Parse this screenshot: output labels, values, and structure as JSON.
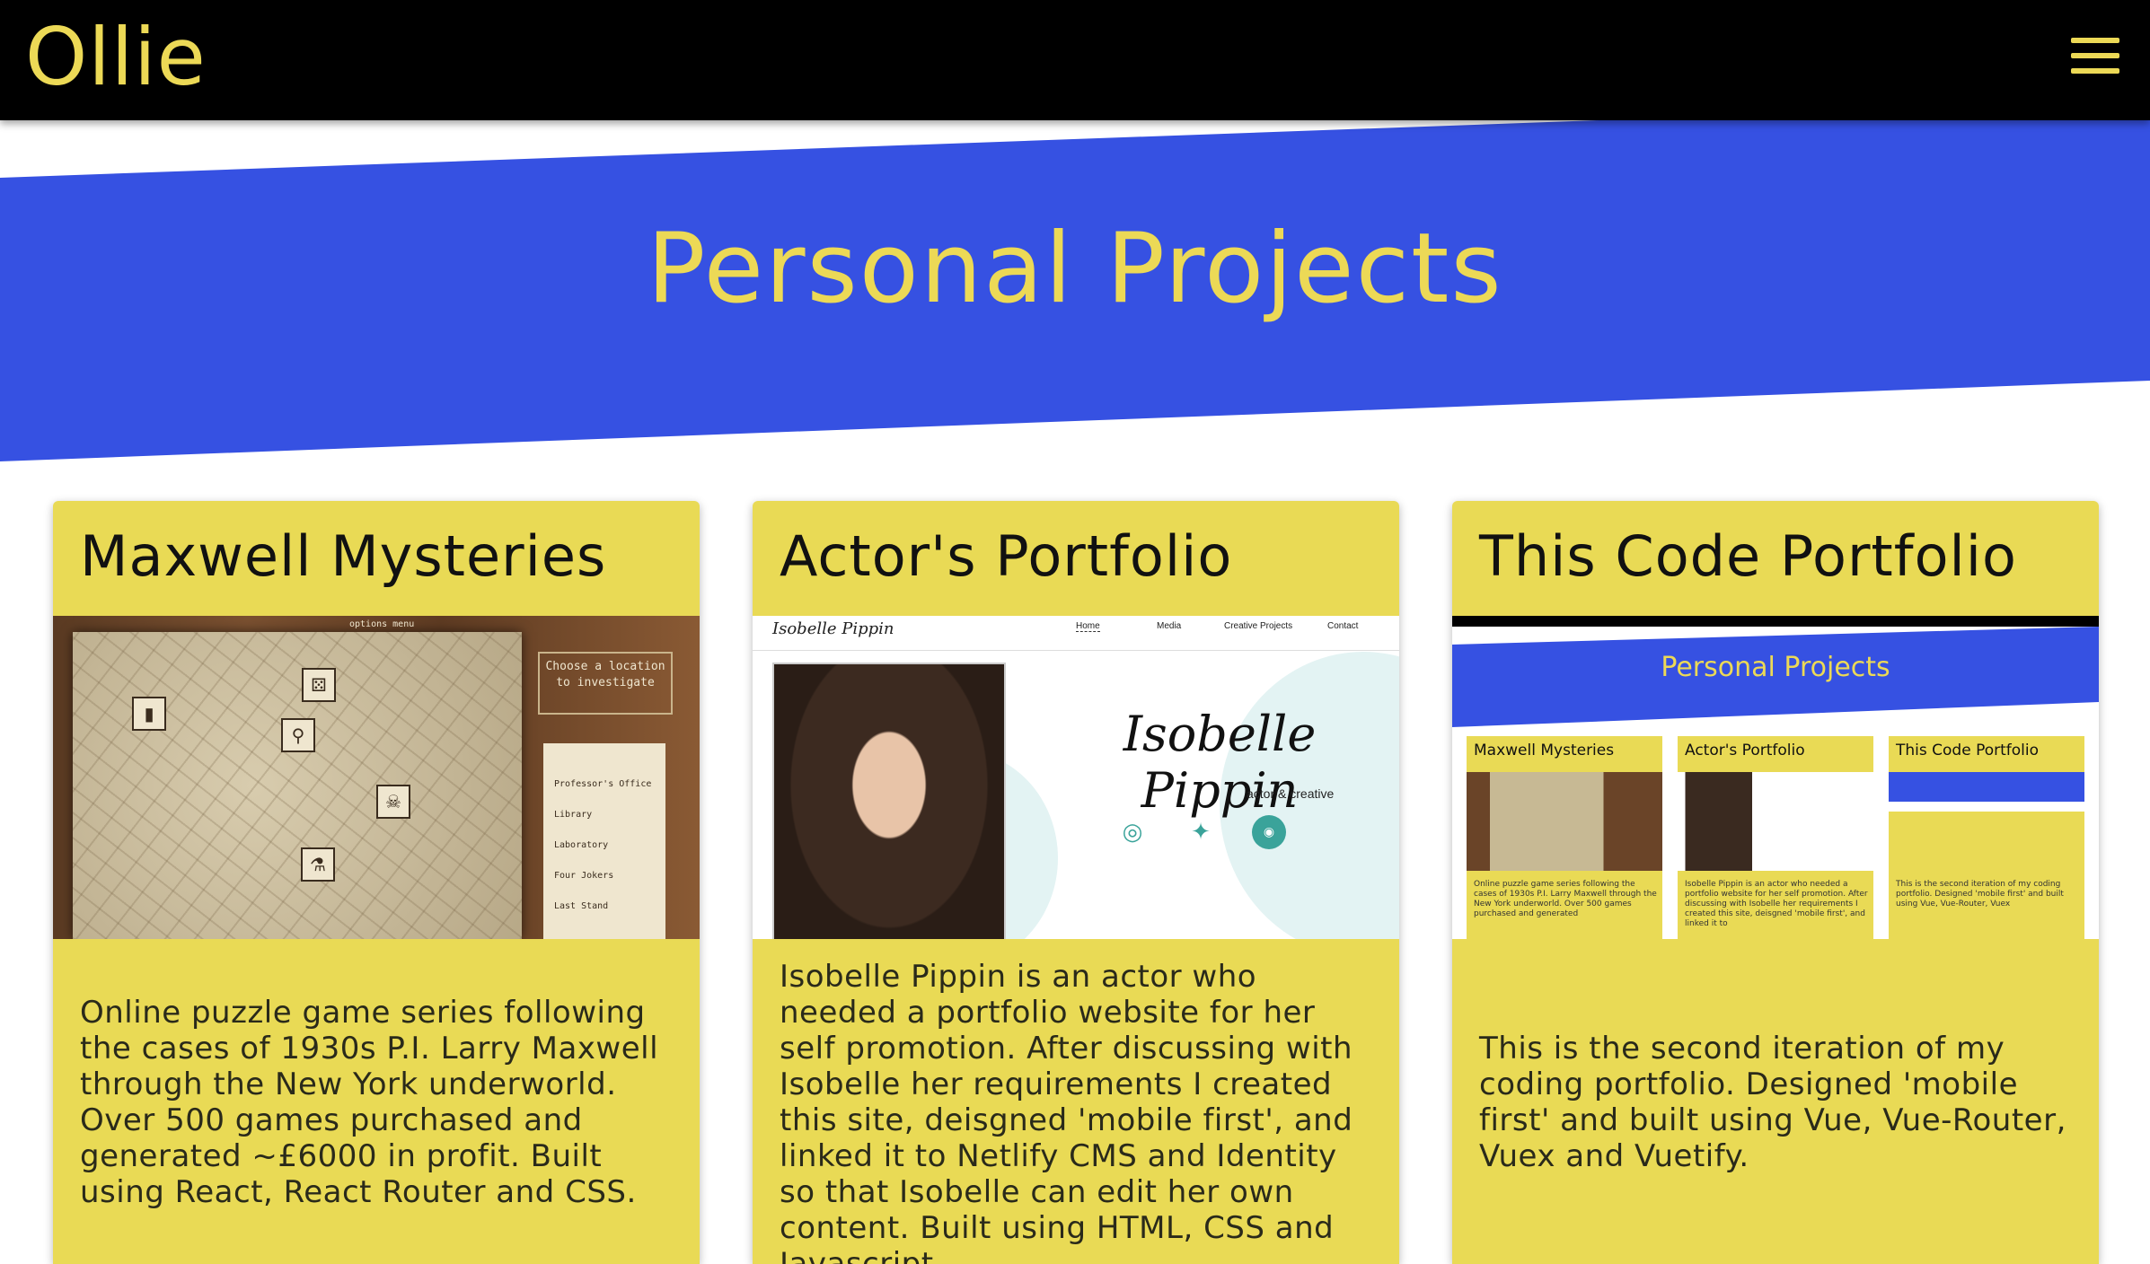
{
  "header": {
    "logo": "Ollie"
  },
  "hero": {
    "title": "Personal Projects"
  },
  "colors": {
    "accent_yellow": "#ecd956",
    "banner_blue": "#3651e2",
    "card_yellow": "#e9da55",
    "header_black": "#000000"
  },
  "cards": [
    {
      "title": "Maxwell Mysteries",
      "description": "Online puzzle game series following the cases of 1930s P.I. Larry Maxwell through the New York underworld. Over 500 games purchased and generated ~£6000 in profit. Built using React, React Router and CSS.",
      "screenshot": {
        "top_text": "options menu",
        "note": "Choose a location to investigate",
        "list": [
          "Professor's Office",
          "Library",
          "Laboratory",
          "Four Jokers",
          "Last Stand"
        ]
      }
    },
    {
      "title": "Actor's Portfolio",
      "description": "Isobelle Pippin is an actor who needed a portfolio website for her self promotion. After discussing with Isobelle her requirements I created this site, deisgned 'mobile first', and linked it to Netlify CMS and Identity so that Isobelle can edit her own content. Built using HTML, CSS and Javascript.",
      "screenshot": {
        "logo": "Isobelle Pippin",
        "nav": [
          "Home",
          "Media",
          "Creative Projects",
          "Contact"
        ],
        "name": "Isobelle Pippin",
        "subtitle": "actor & creative"
      }
    },
    {
      "title": "This Code Portfolio",
      "description": "This is the second iteration of my coding portfolio. Designed 'mobile first' and built using Vue, Vue-Router, Vuex and Vuetify.",
      "screenshot": {
        "title": "Personal Projects",
        "mini_cards": [
          {
            "title": "Maxwell Mysteries",
            "text": "Online puzzle game series following the cases of 1930s P.I. Larry Maxwell through the New York underworld. Over 500 games purchased and generated"
          },
          {
            "title": "Actor's Portfolio",
            "text": "Isobelle Pippin is an actor who needed a portfolio website for her self promotion. After discussing with Isobelle her requirements I created this site, deisgned 'mobile first', and linked it to"
          },
          {
            "title": "This Code Portfolio",
            "text": "This is the second iteration of my coding portfolio. Designed 'mobile first' and built using Vue, Vue-Router, Vuex"
          }
        ]
      }
    }
  ]
}
